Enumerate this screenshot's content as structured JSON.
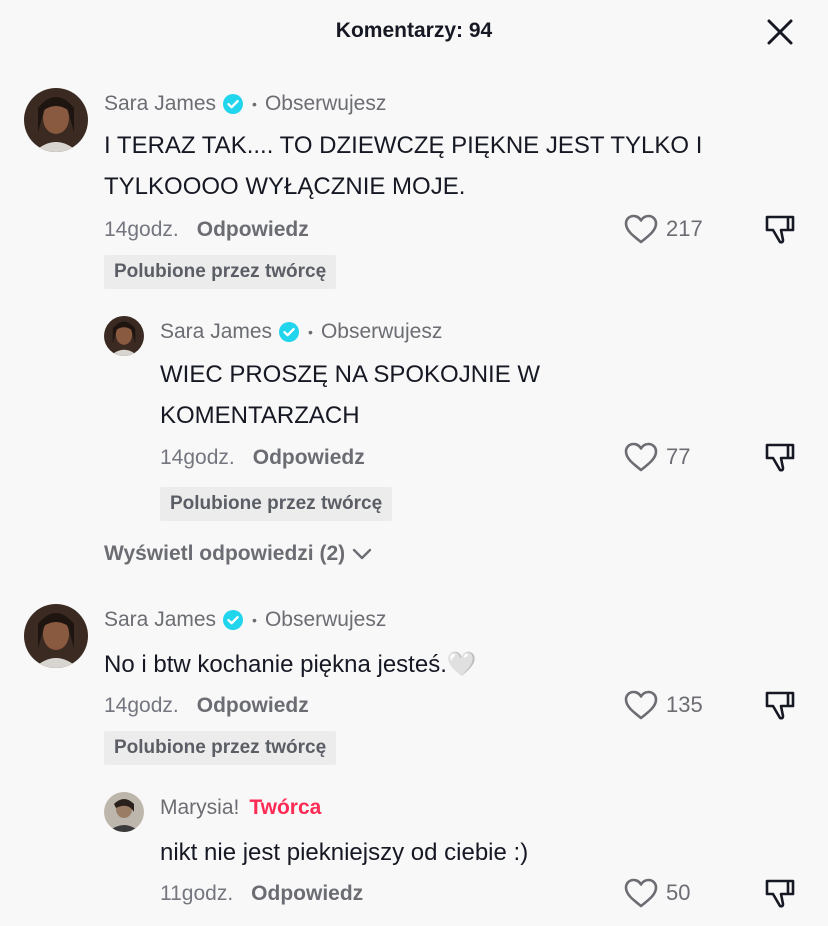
{
  "header": {
    "title": "Komentarzy: 94"
  },
  "comments": [
    {
      "username": "Sara James",
      "follow_status": "Obserwujesz",
      "text": "I TERAZ TAK.... TO DZIEWCZĘ PIĘKNE JEST TYLKO I TYLKOOOO WYŁĄCZNIE MOJE.",
      "time": "14godz.",
      "reply_label": "Odpowiedz",
      "likes": "217",
      "badge": "Polubione przez twórcę"
    },
    {
      "username": "Sara James",
      "follow_status": "Obserwujesz",
      "text": "WIEC PROSZĘ NA SPOKOJNIE W KOMENTARZACH",
      "time": "14godz.",
      "reply_label": "Odpowiedz",
      "likes": "77",
      "badge": "Polubione przez twórcę"
    },
    {
      "username": "Sara James",
      "follow_status": "Obserwujesz",
      "text": "No i btw kochanie piękna jesteś.🤍",
      "time": "14godz.",
      "reply_label": "Odpowiedz",
      "likes": "135",
      "badge": "Polubione przez twórcę"
    },
    {
      "username": "Marysia!",
      "creator_label": "Twórca",
      "text": "nikt nie jest piekniejszy od ciebie :)",
      "time": "11godz.",
      "reply_label": "Odpowiedz",
      "likes": "50"
    }
  ],
  "view_replies": "Wyświetl odpowiedzi (2)",
  "colors": {
    "creator": "#fe2c55",
    "verified": "#20d5ec",
    "badge_bg": "#ececec"
  }
}
